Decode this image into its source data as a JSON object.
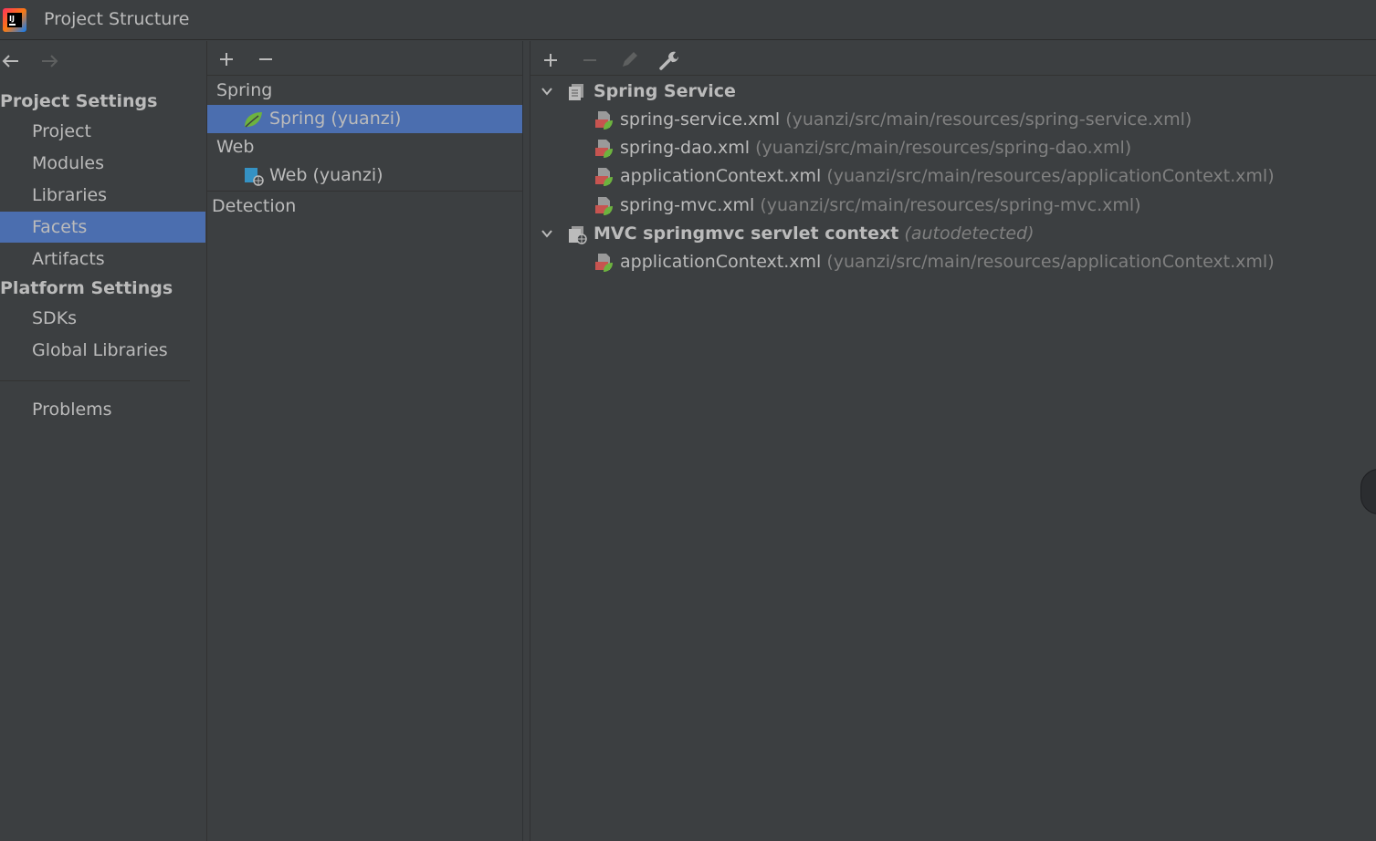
{
  "window": {
    "title": "Project Structure"
  },
  "nav": {
    "sections": [
      {
        "heading": "Project Settings",
        "items": [
          "Project",
          "Modules",
          "Libraries",
          "Facets",
          "Artifacts"
        ]
      },
      {
        "heading": "Platform Settings",
        "items": [
          "SDKs",
          "Global Libraries"
        ]
      }
    ],
    "problems": "Problems",
    "selected": "Facets"
  },
  "facets": {
    "groups": [
      {
        "label": "Spring",
        "child": "Spring (yuanzi)"
      },
      {
        "label": "Web",
        "child": "Web (yuanzi)"
      }
    ],
    "detection": "Detection",
    "selected": "Spring (yuanzi)"
  },
  "fileset": {
    "groups": [
      {
        "name": "Spring Service",
        "note": "",
        "files": [
          {
            "name": "spring-service.xml",
            "path": "(yuanzi/src/main/resources/spring-service.xml)"
          },
          {
            "name": "spring-dao.xml",
            "path": "(yuanzi/src/main/resources/spring-dao.xml)"
          },
          {
            "name": "applicationContext.xml",
            "path": "(yuanzi/src/main/resources/applicationContext.xml)"
          },
          {
            "name": "spring-mvc.xml",
            "path": "(yuanzi/src/main/resources/spring-mvc.xml)"
          }
        ]
      },
      {
        "name": "MVC springmvc servlet context",
        "note": "(autodetected)",
        "files": [
          {
            "name": "applicationContext.xml",
            "path": "(yuanzi/src/main/resources/applicationContext.xml)"
          }
        ]
      }
    ]
  },
  "colors": {
    "background": "#3c3f41",
    "selection": "#4b6eaf",
    "text": "#bbbbbb",
    "muted": "#808080",
    "spring_green": "#6db33f"
  }
}
